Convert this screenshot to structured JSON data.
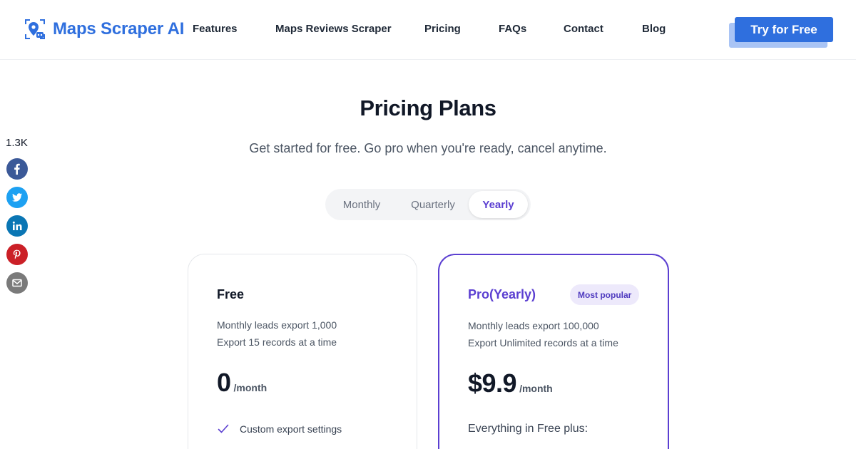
{
  "header": {
    "logo_text": "Maps Scraper AI",
    "nav": [
      "Features",
      "Maps Reviews Scraper",
      "Pricing",
      "FAQs",
      "Contact",
      "Blog"
    ],
    "cta_label": "Try for Free"
  },
  "share": {
    "count": "1.3K",
    "networks": [
      "facebook",
      "twitter",
      "linkedin",
      "pinterest",
      "email"
    ]
  },
  "hero": {
    "title": "Pricing Plans",
    "subtitle": "Get started for free. Go pro when you're ready, cancel anytime."
  },
  "billing": {
    "options": [
      "Monthly",
      "Quarterly",
      "Yearly"
    ],
    "selected": "Yearly"
  },
  "plans": [
    {
      "name": "Free",
      "lines": [
        "Monthly leads export 1,000",
        "Export 15 records at a time"
      ],
      "price": "0",
      "period": "/month",
      "features": [
        "Custom export settings"
      ]
    },
    {
      "name": "Pro(Yearly)",
      "badge": "Most popular",
      "lines": [
        "Monthly leads export 100,000",
        "Export Unlimited records at a time"
      ],
      "price": "$9.9",
      "period": "/month",
      "features_intro": "Everything in Free plus:"
    }
  ],
  "colors": {
    "brand_blue": "#2f6fde",
    "accent_purple": "#5b3fd1",
    "badge_bg": "#ede9fb",
    "facebook": "#3b5998",
    "twitter": "#1da1f2",
    "linkedin": "#0a76b4",
    "pinterest": "#cb2027",
    "email": "#7a7a7a"
  }
}
